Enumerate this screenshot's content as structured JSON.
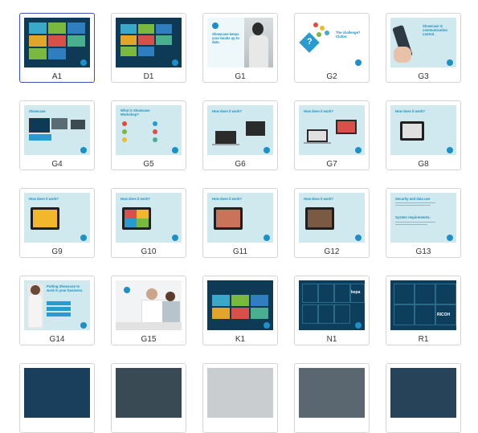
{
  "slides": [
    {
      "label": "A1",
      "selected": true
    },
    {
      "label": "D1"
    },
    {
      "label": "G1",
      "title": "Showcase keeps your books up to date."
    },
    {
      "label": "G2",
      "title": "The challenge? Clutter."
    },
    {
      "label": "G3",
      "title": "Showcase is communication control."
    },
    {
      "label": "G4",
      "title": "Showcase."
    },
    {
      "label": "G5",
      "title": "What is Showcase Workshop?"
    },
    {
      "label": "G6",
      "title": "How does it work?"
    },
    {
      "label": "G7",
      "title": "How does it work?"
    },
    {
      "label": "G8",
      "title": "How does it work?"
    },
    {
      "label": "G9",
      "title": "How does it work?"
    },
    {
      "label": "G10",
      "title": "How does it work?"
    },
    {
      "label": "G11",
      "title": "How does it work?"
    },
    {
      "label": "G12",
      "title": "How does it work?"
    },
    {
      "label": "G13",
      "title": "Security and data use",
      "subtitle": "System requirements."
    },
    {
      "label": "G14",
      "title": "Putting Showcase to work in your business."
    },
    {
      "label": "G15"
    },
    {
      "label": "K1"
    },
    {
      "label": "N1",
      "logo_text": "kepa"
    },
    {
      "label": "R1",
      "logo_text": "RICOH"
    },
    {
      "label": ""
    },
    {
      "label": ""
    },
    {
      "label": ""
    },
    {
      "label": ""
    },
    {
      "label": ""
    }
  ],
  "colors": {
    "selected_border": "#3d4fc9",
    "light_teal": "#cfe9ee",
    "dark_navy": "#0d3e5c",
    "brand_blue": "#1e8fc7"
  }
}
